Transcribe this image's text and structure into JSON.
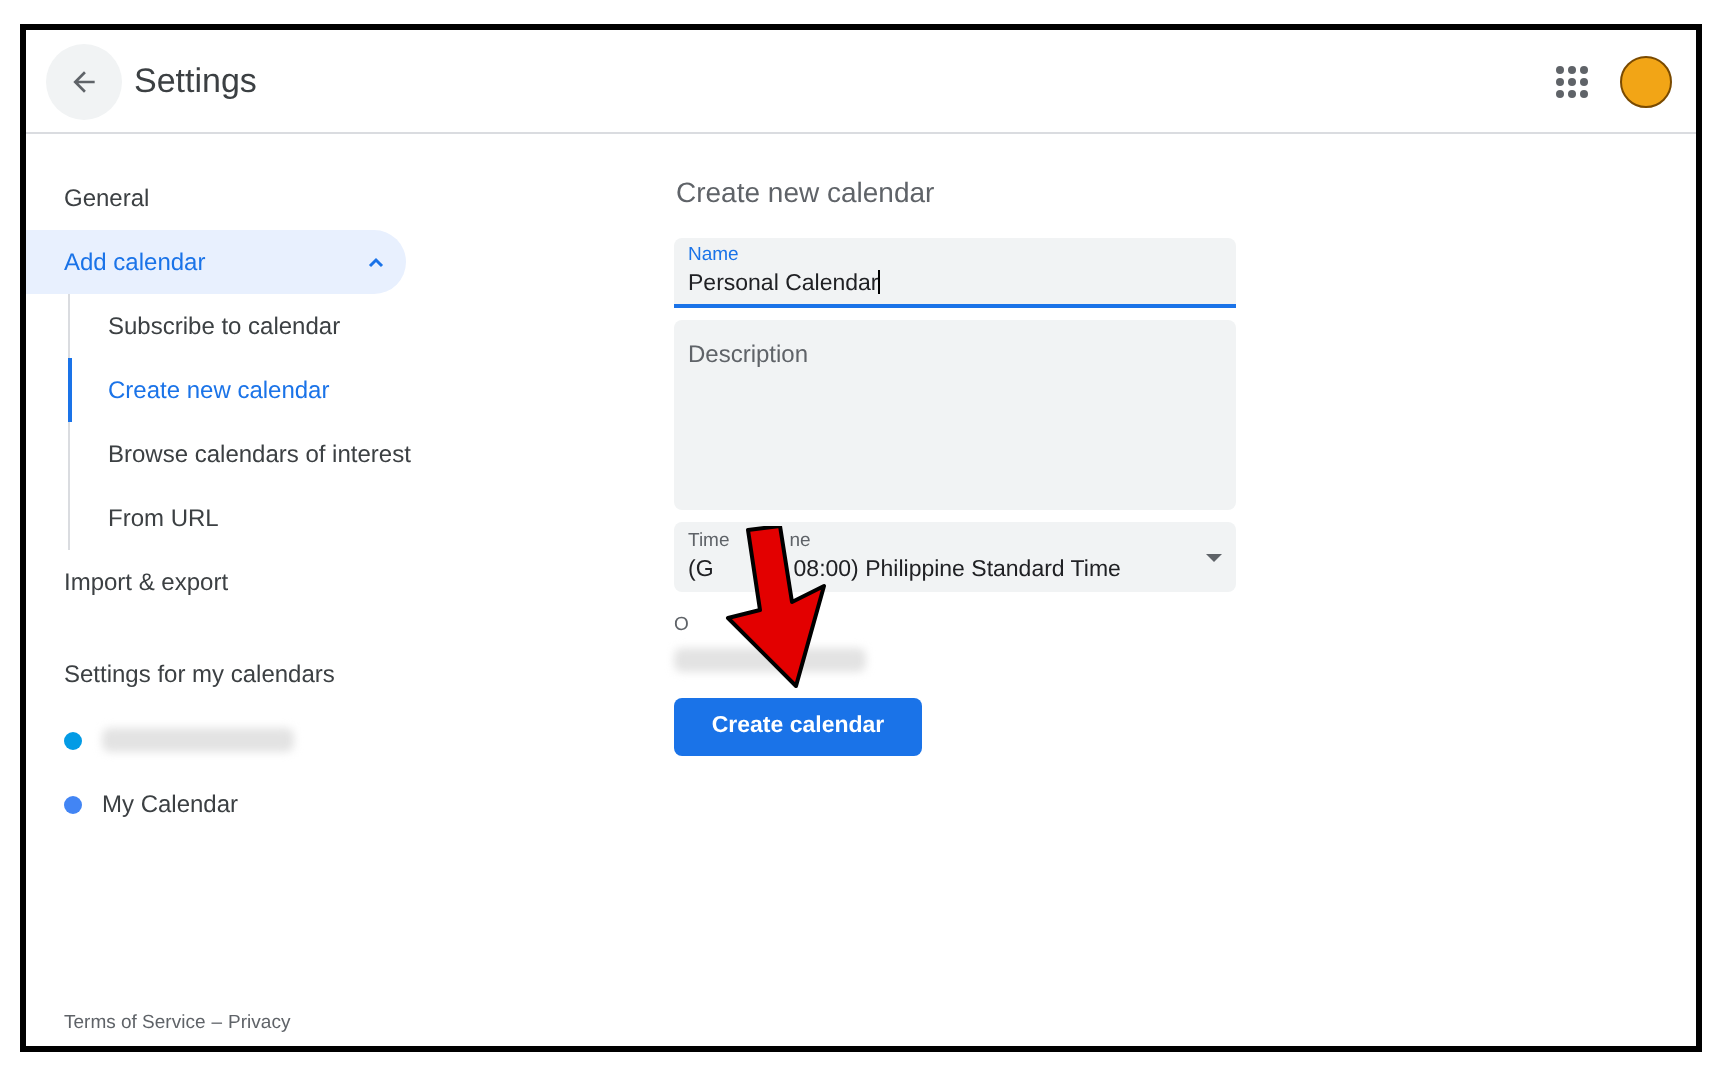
{
  "header": {
    "title": "Settings"
  },
  "sidebar": {
    "items": [
      {
        "label": "General",
        "selected": false
      },
      {
        "label": "Add calendar",
        "selected": false,
        "expanded": true,
        "children": [
          {
            "label": "Subscribe to calendar",
            "selected": false
          },
          {
            "label": "Create new calendar",
            "selected": true
          },
          {
            "label": "Browse calendars of interest",
            "selected": false
          },
          {
            "label": "From URL",
            "selected": false
          }
        ]
      },
      {
        "label": "Import & export",
        "selected": false
      }
    ],
    "section_title": "Settings for my calendars",
    "calendars": [
      {
        "redacted": true,
        "color": "#039be5"
      },
      {
        "label": "My Calendar",
        "redacted": false,
        "color": "#4285f4"
      }
    ],
    "footer": {
      "terms": "Terms of Service",
      "separator": "–",
      "privacy": "Privacy"
    }
  },
  "form": {
    "title": "Create new calendar",
    "name": {
      "label": "Name",
      "value": "Personal Calendar"
    },
    "description": {
      "placeholder": "Description"
    },
    "time_zone": {
      "label_parts": [
        "Time",
        "ne"
      ],
      "value_parts": [
        "(G",
        "08:00) Philippine Standard Time"
      ]
    },
    "owner": {
      "label": "O",
      "redacted": true
    },
    "submit": "Create calendar"
  }
}
